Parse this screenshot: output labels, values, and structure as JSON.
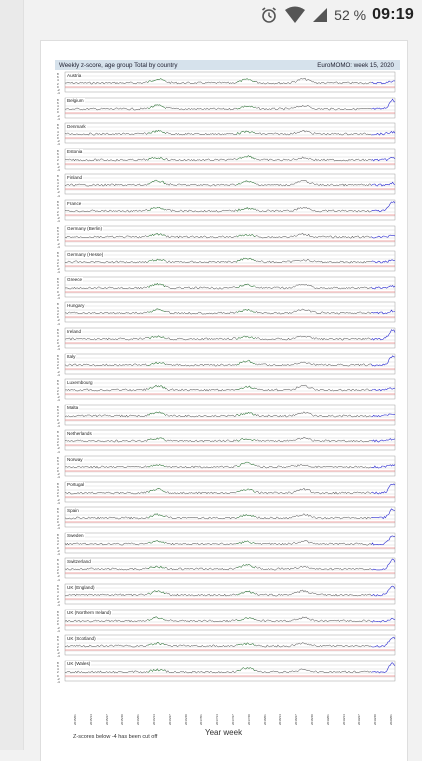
{
  "status_bar": {
    "battery_percent": "52 %",
    "time": "09:19"
  },
  "figure": {
    "title": "Weekly z-score, age group Total by country",
    "week_label": "EuroMOMO: week 15, 2020",
    "y_tick_labels": [
      "8",
      "6",
      "4",
      "2",
      "0",
      "-2",
      "-4"
    ],
    "countries": [
      "Austria",
      "Belgium",
      "Denmark",
      "Estonia",
      "Finland",
      "France",
      "Germany (Berlin)",
      "Germany (Hesse)",
      "Greece",
      "Hungary",
      "Ireland",
      "Italy",
      "Luxembourg",
      "Malta",
      "Netherlands",
      "Norway",
      "Portugal",
      "Spain",
      "Sweden",
      "Switzerland",
      "UK (England)",
      "UK (Northern Ireland)",
      "UK (Scotland)",
      "UK (Wales)"
    ],
    "x_ticks": [
      "2015/01",
      "2015/14",
      "2015/27",
      "2015/40",
      "2016/01",
      "2016/14",
      "2016/27",
      "2016/40",
      "2017/01",
      "2017/14",
      "2017/27",
      "2017/40",
      "2018/01",
      "2018/14",
      "2018/27",
      "2018/40",
      "2019/01",
      "2019/14",
      "2019/27",
      "2019/40",
      "2020/01"
    ],
    "x_label": "Year week",
    "footnote": "Z-scores below -4 has been cut off",
    "colors": {
      "series": "#2a2a2a",
      "winter_peak": "#2e8b3a",
      "recent": "#2b2bd0",
      "reference_line": "#e35050",
      "grid": "#bdbdbd"
    }
  }
}
